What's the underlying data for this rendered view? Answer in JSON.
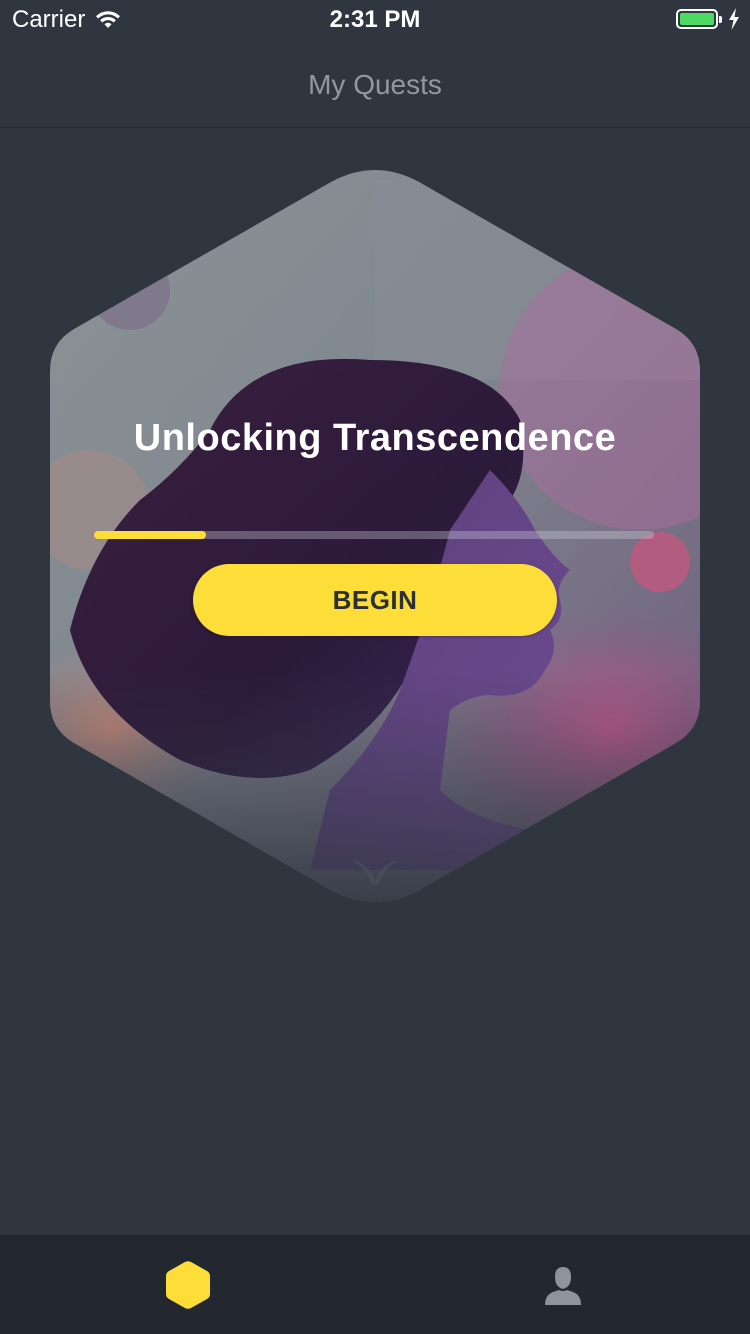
{
  "status_bar": {
    "carrier": "Carrier",
    "time": "2:31 PM",
    "battery_color": "#4cd964"
  },
  "nav": {
    "title": "My Quests"
  },
  "quest": {
    "title": "Unlocking Transcendence",
    "progress_fraction": 0.2,
    "begin_label": "BEGIN",
    "accent_color": "#fddd38"
  },
  "tab_bar": {
    "tabs": [
      {
        "icon": "hexagon-icon",
        "active": true,
        "color": "#fddd38"
      },
      {
        "icon": "person-icon",
        "active": false,
        "color": "#8e949c"
      }
    ]
  }
}
